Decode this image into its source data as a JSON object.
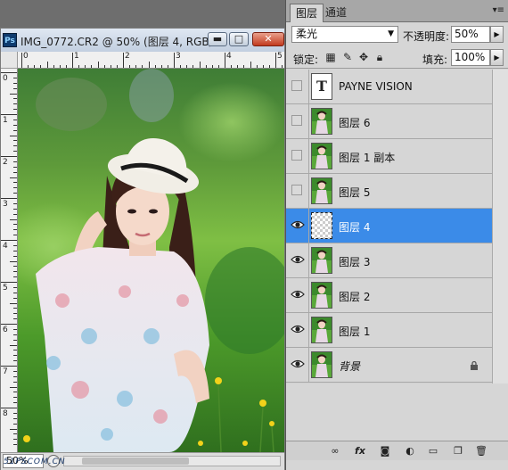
{
  "document": {
    "title": "IMG_0772.CR2 @ 50% (图层 4, RGB/...",
    "app_icon": "Ps",
    "minimize": "▬",
    "maximize": "□",
    "close": "✕",
    "zoom": "50%",
    "ruler_h": [
      "0",
      "1",
      "2",
      "3",
      "4",
      "5"
    ],
    "ruler_v": [
      "0",
      "1",
      "2",
      "3",
      "4",
      "5",
      "6",
      "7",
      "8"
    ],
    "watermark": "51PSCOM.CN"
  },
  "panel": {
    "tabs": [
      "图层",
      "通道"
    ],
    "menu": "▾≡",
    "blend_mode": "柔光",
    "opacity_label": "不透明度:",
    "opacity_value": "50%",
    "lock_label": "锁定:",
    "fill_label": "填充:",
    "fill_value": "100%",
    "layers": [
      {
        "name": "PAYNE VISION",
        "visible": false,
        "thumb": "text",
        "thumb_text": "T"
      },
      {
        "name": "图层 6",
        "visible": false,
        "thumb": "photo"
      },
      {
        "name": "图层 1 副本",
        "visible": false,
        "thumb": "photo"
      },
      {
        "name": "图层 5",
        "visible": false,
        "thumb": "photo"
      },
      {
        "name": "图层 4",
        "visible": true,
        "thumb": "transparent",
        "selected": true
      },
      {
        "name": "图层 3",
        "visible": true,
        "thumb": "photo"
      },
      {
        "name": "图层 2",
        "visible": true,
        "thumb": "photo"
      },
      {
        "name": "图层 1",
        "visible": true,
        "thumb": "photo"
      },
      {
        "name": "背景",
        "visible": true,
        "thumb": "photo",
        "locked": true
      }
    ],
    "bottom_icons": [
      "link-icon",
      "fx-icon",
      "mask-icon",
      "adjustment-icon",
      "group-icon",
      "new-layer-icon",
      "trash-icon"
    ],
    "fx_label": "fx"
  },
  "colors": {
    "selection": "#3b8be8",
    "panel_bg": "#d6d6d6",
    "titlebar": "#c2cfe0",
    "close_button": "#c23a1e"
  }
}
